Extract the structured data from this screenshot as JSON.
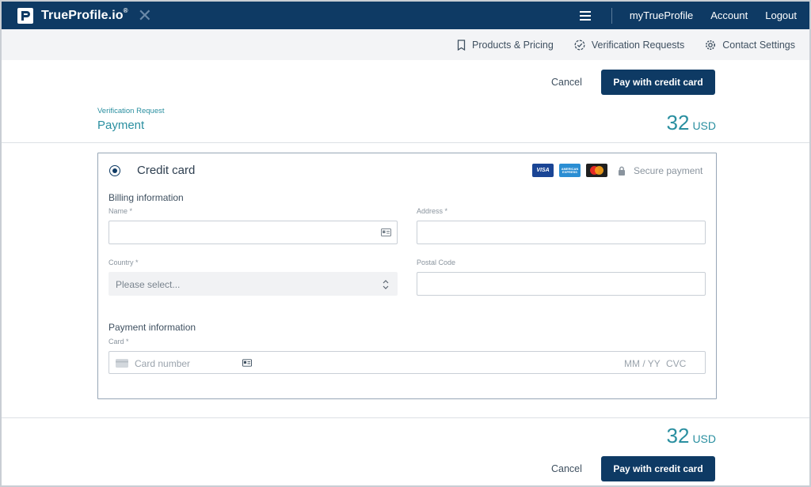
{
  "app": {
    "logo_text": "TrueProfile.io",
    "logo_reg": "®",
    "close_glyph": "✕"
  },
  "topnav": {
    "items": [
      "myTrueProfile",
      "Account",
      "Logout"
    ]
  },
  "subnav": {
    "items": [
      {
        "label": "Products & Pricing",
        "icon": "bookmark-icon"
      },
      {
        "label": "Verification Requests",
        "icon": "check-circle-icon"
      },
      {
        "label": "Contact Settings",
        "icon": "gear-icon"
      }
    ]
  },
  "actions": {
    "cancel_label": "Cancel",
    "pay_label": "Pay with credit card"
  },
  "header": {
    "breadcrumb": "Verification Request",
    "title": "Payment"
  },
  "price": {
    "amount": "32",
    "currency": "USD"
  },
  "payment_method": {
    "label": "Credit card",
    "selected": true,
    "cards": [
      "VISA",
      "AMERICAN EXPRESS",
      "mastercard"
    ],
    "secure_label": "Secure payment"
  },
  "billing": {
    "section_label": "Billing information",
    "name_label": "Name *",
    "name_value": "",
    "address_label": "Address *",
    "address_value": "",
    "country_label": "Country *",
    "country_placeholder": "Please select...",
    "postal_label": "Postal Code",
    "postal_value": ""
  },
  "payment_info": {
    "section_label": "Payment information",
    "card_label": "Card *",
    "card_number_placeholder": "Card number",
    "expiry_placeholder": "MM / YY",
    "cvc_placeholder": "CVC"
  },
  "colors": {
    "brand_navy": "#0e3a64",
    "accent_teal": "#2a8fa0"
  }
}
